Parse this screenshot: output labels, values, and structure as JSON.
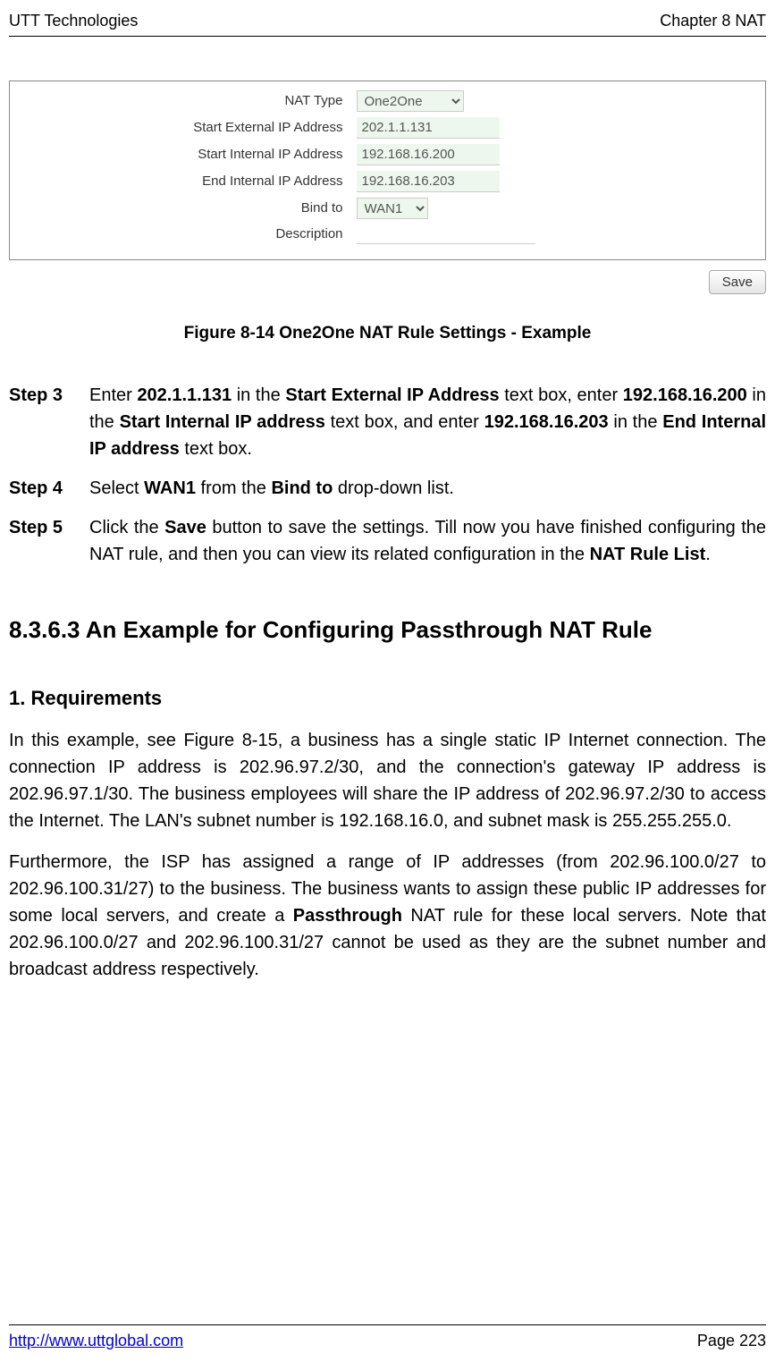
{
  "header": {
    "left": "UTT Technologies",
    "right": "Chapter 8 NAT"
  },
  "figure": {
    "form": {
      "nat_type_label": "NAT Type",
      "nat_type_value": "One2One",
      "start_ext_label": "Start External IP Address",
      "start_ext_value": "202.1.1.131",
      "start_int_label": "Start Internal IP Address",
      "start_int_value": "192.168.16.200",
      "end_int_label": "End Internal IP Address",
      "end_int_value": "192.168.16.203",
      "bind_label": "Bind to",
      "bind_value": "WAN1",
      "desc_label": "Description",
      "desc_value": ""
    },
    "save_button": "Save",
    "caption": "Figure 8-14 One2One NAT Rule Settings - Example"
  },
  "steps": {
    "step3": {
      "label": "Step 3",
      "t1": "Enter ",
      "b1": "202.1.1.131",
      "t2": " in the ",
      "b2": "Start External IP Address",
      "t3": " text box, enter ",
      "b3": "192.168.16.200",
      "t4": " in the ",
      "b4": "Start Internal IP address",
      "t5": " text box, and enter ",
      "b5": "192.168.16.203",
      "t6": " in the ",
      "b6": "End Internal IP address",
      "t7": " text box."
    },
    "step4": {
      "label": "Step 4",
      "t1": "Select ",
      "b1": "WAN1",
      "t2": " from the ",
      "b2": "Bind to",
      "t3": " drop-down list."
    },
    "step5": {
      "label": "Step 5",
      "t1": "Click the ",
      "b1": "Save",
      "t2": " button to save the settings. Till now you have finished configuring the NAT rule, and then you can view its related configuration in the ",
      "b2": "NAT Rule List",
      "t3": "."
    }
  },
  "section": {
    "heading": "8.3.6.3  An Example for Configuring Passthrough NAT Rule",
    "req_heading": "1.   Requirements",
    "para1": "In this example, see Figure 8-15, a business has a single static IP Internet connection. The connection IP address is 202.96.97.2/30, and the connection's gateway IP address is 202.96.97.1/30. The business employees will share the IP address of 202.96.97.2/30 to access the Internet. The LAN's subnet number is 192.168.16.0, and subnet mask is 255.255.255.0.",
    "para2_t1": "Furthermore, the ISP has assigned a range of IP addresses (from 202.96.100.0/27 to 202.96.100.31/27) to the business. The business wants to assign these public IP addresses for some local servers, and create a ",
    "para2_b1": "Passthrough",
    "para2_t2": " NAT rule for these local servers. Note that 202.96.100.0/27 and 202.96.100.31/27 cannot be used as they are the subnet number and broadcast address respectively."
  },
  "footer": {
    "url": "http://www.uttglobal.com",
    "page_label": "Page 223"
  }
}
